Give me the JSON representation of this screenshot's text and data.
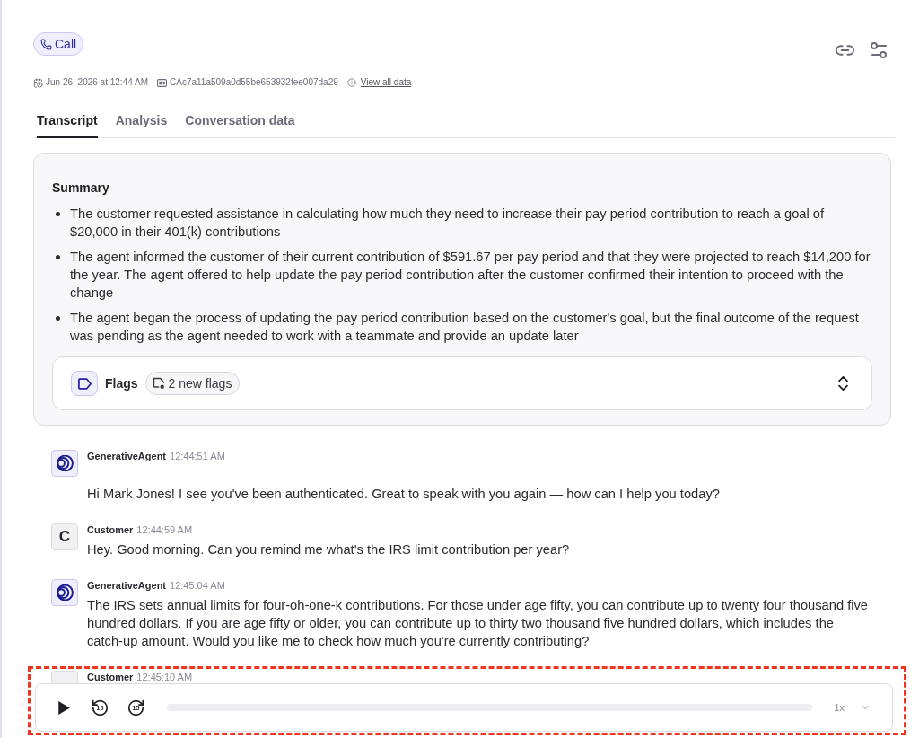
{
  "call_badge": {
    "label": "Call"
  },
  "meta": {
    "date": "Jun 26, 2026 at 12:44 AM",
    "conversation_id": "CAc7a11a509a0d55be653932fee007da29",
    "link": "View all data"
  },
  "tabs": [
    {
      "label": "Transcript",
      "selected": true
    },
    {
      "label": "Analysis",
      "selected": false
    },
    {
      "label": "Conversation data",
      "selected": false
    }
  ],
  "summary": {
    "title": "Summary",
    "bullets": [
      "The customer requested assistance in calculating how much they need to increase their pay period contribution to reach a goal of $20,000 in their 401(k) contributions",
      "The agent informed the customer of their current contribution of $591.67 per pay period and that they were projected to reach $14,200 for the year. The agent offered to help update the pay period contribution after the customer confirmed their intention to proceed with the change",
      "The agent began the process of updating the pay period contribution based on the customer's goal, but the final outcome of the request was pending as the agent needed to work with a teammate and provide an update later"
    ],
    "flags": {
      "label": "Flags",
      "badge": "2 new flags"
    }
  },
  "messages": [
    {
      "kind": "agent",
      "sender": "GenerativeAgent",
      "time": "12:44:51 AM",
      "text": "Hi Mark Jones! I see you've been authenticated. Great to speak with you again — how can I help you today?"
    },
    {
      "kind": "customer",
      "sender": "Customer",
      "avatar": "C",
      "time": "12:44:59 AM",
      "text": "Hey. Good morning. Can you remind me what's the IRS limit contribution per year?"
    },
    {
      "kind": "agent",
      "sender": "GenerativeAgent",
      "time": "12:45:04 AM",
      "text": "The IRS sets annual limits for four-oh-one-k contributions. For those under age fifty, you can contribute up to twenty four thousand five hundred dollars. If you are age fifty or older, you can contribute up to thirty two thousand five hundred dollars, which includes the catch-up amount. Would you like me to check how much you're currently contributing?"
    },
    {
      "kind": "customer",
      "sender": "Customer",
      "time": "12:45:10 AM"
    }
  ],
  "player": {
    "skip_back": "15",
    "skip_forward": "15",
    "speed": "1x"
  }
}
